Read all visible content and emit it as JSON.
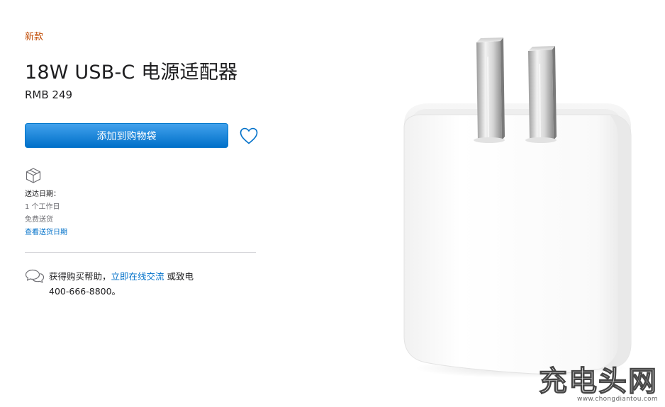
{
  "product": {
    "badge": "新款",
    "title": "18W USB-C 电源适配器",
    "price": "RMB 249",
    "add_to_bag_label": "添加到购物袋"
  },
  "delivery": {
    "label": "送达日期：",
    "eta": "1 个工作日",
    "shipping": "免费送货",
    "check_dates_link": "查看送货日期"
  },
  "help": {
    "prefix": "获得购买帮助，",
    "chat_link": "立即在线交流",
    "middle": " 或致电",
    "phone": "400-666-8800。"
  },
  "watermark": {
    "name": "充电头网",
    "url": "www.chongdiantou.com"
  },
  "icons": {
    "favorite": "heart-icon",
    "delivery": "box-icon",
    "help": "chat-bubbles-icon"
  },
  "colors": {
    "badge": "#bf4800",
    "button": "#0070c9",
    "link": "#0070c9"
  }
}
